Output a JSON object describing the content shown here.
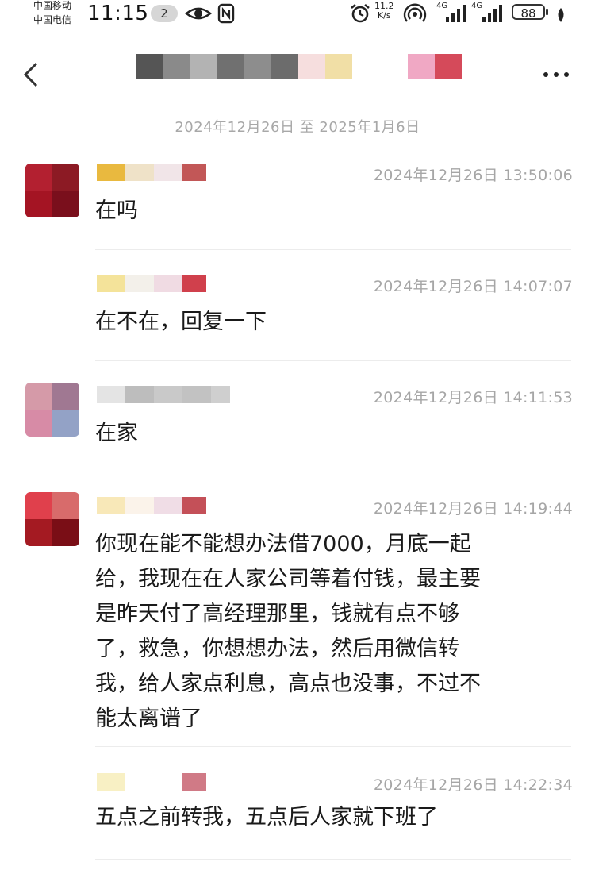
{
  "status_bar": {
    "carrier_1": "中国移动",
    "carrier_2": "中国电信",
    "time": "11:15",
    "notification_count": "2",
    "net_speed_value": "11.2",
    "net_speed_unit": "K/s",
    "network_1": "4G",
    "network_2": "4G",
    "battery_level": "88"
  },
  "header": {
    "back_icon": "chevron-left-icon",
    "more_icon": "more-horizontal-icon"
  },
  "date_range": "2024年12月26日 至 2025年1月6日",
  "messages": [
    {
      "timestamp": "2024年12月26日 13:50:06",
      "text": "在吗"
    },
    {
      "timestamp": "2024年12月26日 14:07:07",
      "text": "在不在，回复一下"
    },
    {
      "timestamp": "2024年12月26日 14:11:53",
      "text": "在家"
    },
    {
      "timestamp": "2024年12月26日 14:19:44",
      "lines": [
        "你现在能不能想办法借7000，月底一起",
        "给，我现在在人家公司等着付钱，最主要",
        "是昨天付了高经理那里，钱就有点不够",
        "了，救急，你想想办法，然后用微信转",
        "我，给人家点利息，高点也没事，不过不",
        "能太离谱了"
      ]
    },
    {
      "timestamp": "2024年12月26日 14:22:34",
      "text": "五点之前转我，五点后人家就下班了"
    }
  ],
  "colors": {
    "background": "#ffffff",
    "timestamp": "#a6a6a6",
    "divider": "#ececec",
    "text": "#1a1a1a"
  }
}
